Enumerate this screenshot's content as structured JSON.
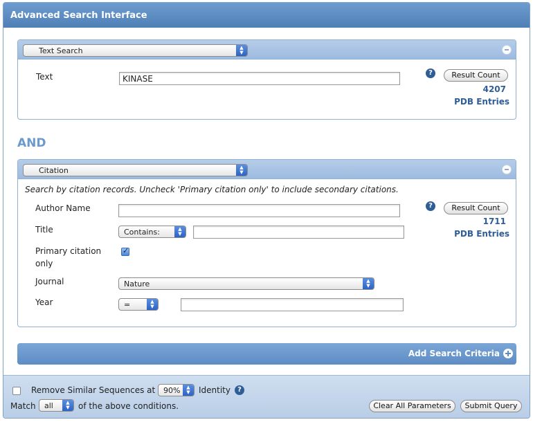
{
  "window": {
    "title": "Advanced Search Interface"
  },
  "panel1": {
    "type_select": "Text Search",
    "text_label": "Text",
    "text_value": "KINASE",
    "result_button": "Result Count",
    "count": "4207",
    "count_unit": "PDB Entries"
  },
  "and_label": "AND",
  "panel2": {
    "type_select": "Citation",
    "description": "Search by citation records. Uncheck 'Primary citation only' to include secondary citations.",
    "author_label": "Author Name",
    "author_value": "",
    "title_label": "Title",
    "title_op": "Contains:",
    "title_value": "",
    "primary_label_line1": "Primary citation",
    "primary_label_line2": "only",
    "primary_checked": true,
    "journal_label": "Journal",
    "journal_value": "Nature",
    "year_label": "Year",
    "year_op": "=",
    "year_value": "",
    "result_button": "Result Count",
    "count": "1711",
    "count_unit": "PDB Entries"
  },
  "add_criteria": "Add Search Criteria",
  "footer": {
    "remove_similar_label": "Remove Similar Sequences at",
    "identity_value": "90%",
    "identity_label": "Identity",
    "match_label": "Match",
    "match_value": "all",
    "conditions_label": "of the above conditions.",
    "clear_button": "Clear All Parameters",
    "submit_button": "Submit Query"
  },
  "colors": {
    "accent": "#4f7fb5",
    "count_text": "#2f5d96",
    "and_text": "#6a9ace"
  }
}
